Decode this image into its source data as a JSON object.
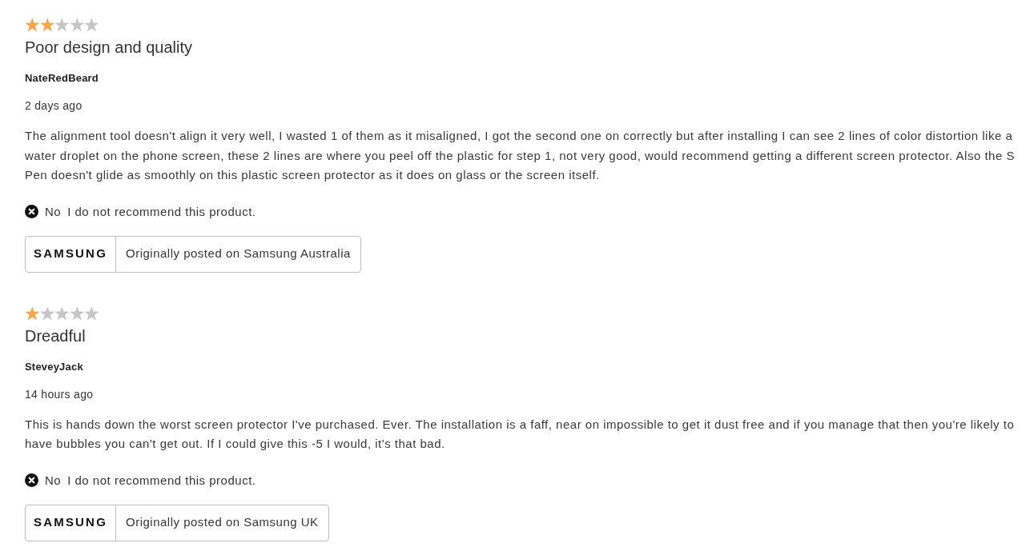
{
  "reviews": [
    {
      "stars": 2,
      "title": "Poor design and quality",
      "author": "NateRedBeard",
      "date": "2 days ago",
      "body": "The alignment tool doesn't align it very well, I wasted 1 of them as it misaligned, I got the second one on correctly but after installing I can see 2 lines of color distortion like a water droplet on the phone screen, these 2 lines are where you peel off the plastic for step 1, not very good, would recommend getting a different screen protector. Also the S Pen doesn't glide as smoothly on this plastic screen protector as it does on glass or the screen itself.",
      "recommendation": {
        "recommended": false,
        "answer": "No",
        "text": "I do not recommend this product."
      },
      "source": {
        "logo": "SAMSUNG",
        "text": "Originally posted on Samsung Australia"
      }
    },
    {
      "stars": 1,
      "title": "Dreadful",
      "author": "SteveyJack",
      "date": "14 hours ago",
      "body": "This is hands down the worst screen protector I've purchased. Ever. The installation is a faff, near on impossible to get it dust free and if you manage that then you're likely to have bubbles you can't get out. If I could give this -5 I would, it's that bad.",
      "recommendation": {
        "recommended": false,
        "answer": "No",
        "text": "I do not recommend this product."
      },
      "source": {
        "logo": "SAMSUNG",
        "text": "Originally posted on Samsung UK"
      }
    }
  ]
}
